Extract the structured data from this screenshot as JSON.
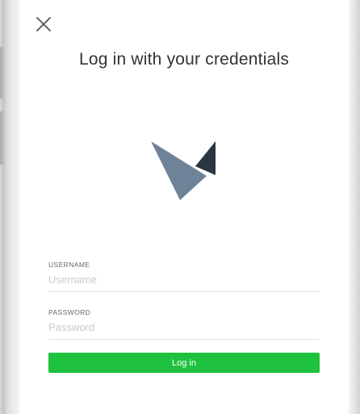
{
  "screen": {
    "title": "Log in with your credentials",
    "close_icon": "close-icon",
    "logo_icon": "logo-icon"
  },
  "form": {
    "username": {
      "label": "USERNAME",
      "placeholder": "Username",
      "value": ""
    },
    "password": {
      "label": "PASSWORD",
      "placeholder": "Password",
      "value": ""
    },
    "submit_label": "Log in"
  },
  "colors": {
    "accent": "#1ec23e",
    "logo_light": "#6e8298",
    "logo_dark": "#2a3542"
  }
}
